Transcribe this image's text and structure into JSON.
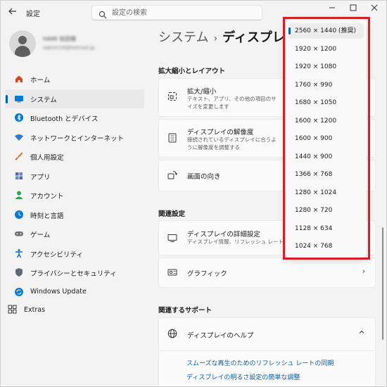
{
  "window": {
    "title": "設定",
    "back_icon": "back-arrow-icon",
    "controls": [
      "minimize-icon",
      "maximize-icon",
      "close-icon"
    ]
  },
  "search": {
    "placeholder": "設定の検索",
    "icon": "search-icon"
  },
  "profile": {
    "name": "HAMI 佑田雅",
    "email": "sakimi19@hotmail.jp"
  },
  "sidebar": {
    "items": [
      {
        "label": "ホーム",
        "icon": "home-icon",
        "color": "#d04a1f",
        "active": false
      },
      {
        "label": "システム",
        "icon": "system-icon",
        "color": "#0078d4",
        "active": true
      },
      {
        "label": "Bluetooth とデバイス",
        "icon": "bluetooth-icon",
        "color": "#0078d4",
        "active": false
      },
      {
        "label": "ネットワークとインターネット",
        "icon": "wifi-icon",
        "color": "#2b7bd6",
        "active": false
      },
      {
        "label": "個人用設定",
        "icon": "brush-icon",
        "color": "#e87a2e",
        "active": false
      },
      {
        "label": "アプリ",
        "icon": "apps-icon",
        "color": "#4c6aa8",
        "active": false
      },
      {
        "label": "アカウント",
        "icon": "account-icon",
        "color": "#2fa44f",
        "active": false
      },
      {
        "label": "時刻と言語",
        "icon": "globe-clock-icon",
        "color": "#0a7ad1",
        "active": false
      },
      {
        "label": "ゲーム",
        "icon": "gamepad-icon",
        "color": "#707070",
        "active": false
      },
      {
        "label": "アクセシビリティ",
        "icon": "accessibility-icon",
        "color": "#0a6cc2",
        "active": false
      },
      {
        "label": "プライバシーとセキュリティ",
        "icon": "shield-icon",
        "color": "#5e6a78",
        "active": false
      },
      {
        "label": "Windows Update",
        "icon": "update-icon",
        "color": "#0a7ad1",
        "active": false
      }
    ],
    "extras": {
      "label": "Extras",
      "icon": "extras-icon"
    }
  },
  "breadcrumb": {
    "parent": "システム",
    "current": "ディスプレイ"
  },
  "sections": {
    "scale_layout": {
      "heading": "拡大縮小とレイアウト",
      "cards": [
        {
          "title": "拡大/縮小",
          "desc": "テキスト、アプリ、その他の項目のサイズを変更します",
          "icon": "zoom-icon"
        },
        {
          "title": "ディスプレイの解像度",
          "desc": "接続されているディスプレイに合うように解像度を調整する",
          "icon": "resolution-icon"
        },
        {
          "title": "画面の向き",
          "desc": "",
          "icon": "orientation-icon"
        }
      ]
    },
    "related": {
      "heading": "関連設定",
      "cards": [
        {
          "title": "ディスプレイの詳細設定",
          "desc": "ディスプレイ情報、リフレッシュ レート",
          "icon": "monitor-icon"
        },
        {
          "title": "グラフィック",
          "desc": "",
          "icon": "graphics-icon"
        }
      ]
    },
    "support": {
      "heading": "関連するサポート",
      "card_title": "ディスプレイのヘルプ",
      "card_icon": "globe-icon",
      "links": [
        "スムーズな再生のためのリフレッシュ レートの同期",
        "ディスプレイの明るさ設定の簡単な調整"
      ]
    }
  },
  "resolution_dropdown": {
    "options": [
      "2560 × 1440 (推奨)",
      "1920 × 1200",
      "1920 × 1080",
      "1760 × 990",
      "1680 × 1050",
      "1600 × 1200",
      "1600 × 900",
      "1440 × 900",
      "1366 × 768",
      "1280 × 1024",
      "1280 × 720",
      "1128 × 634",
      "1024 × 768"
    ],
    "selected_index": 0,
    "highlight_color": "#d41f27"
  }
}
